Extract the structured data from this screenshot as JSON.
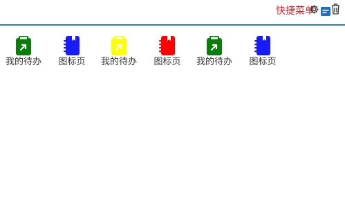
{
  "header": {
    "title": "快捷菜单",
    "icons": [
      "gear-icon",
      "card-icon",
      "trash-icon"
    ]
  },
  "colors": {
    "header_rule": "#2f7fb8",
    "title": "#e0242c",
    "label": "#333333"
  },
  "apps": [
    {
      "label": "我的待办",
      "icon": "clipboard-arrow-icon",
      "color": "#0a7d0a"
    },
    {
      "label": "图标页",
      "icon": "notebook-icon",
      "color": "#1a1aff"
    },
    {
      "label": "我的待办",
      "icon": "clipboard-arrow-icon",
      "color": "#ffff00"
    },
    {
      "label": "图标页",
      "icon": "notebook-icon",
      "color": "#ff0000"
    },
    {
      "label": "我的待办",
      "icon": "clipboard-arrow-icon",
      "color": "#0a7d0a"
    },
    {
      "label": "图标页",
      "icon": "notebook-icon",
      "color": "#1a1aff"
    }
  ]
}
